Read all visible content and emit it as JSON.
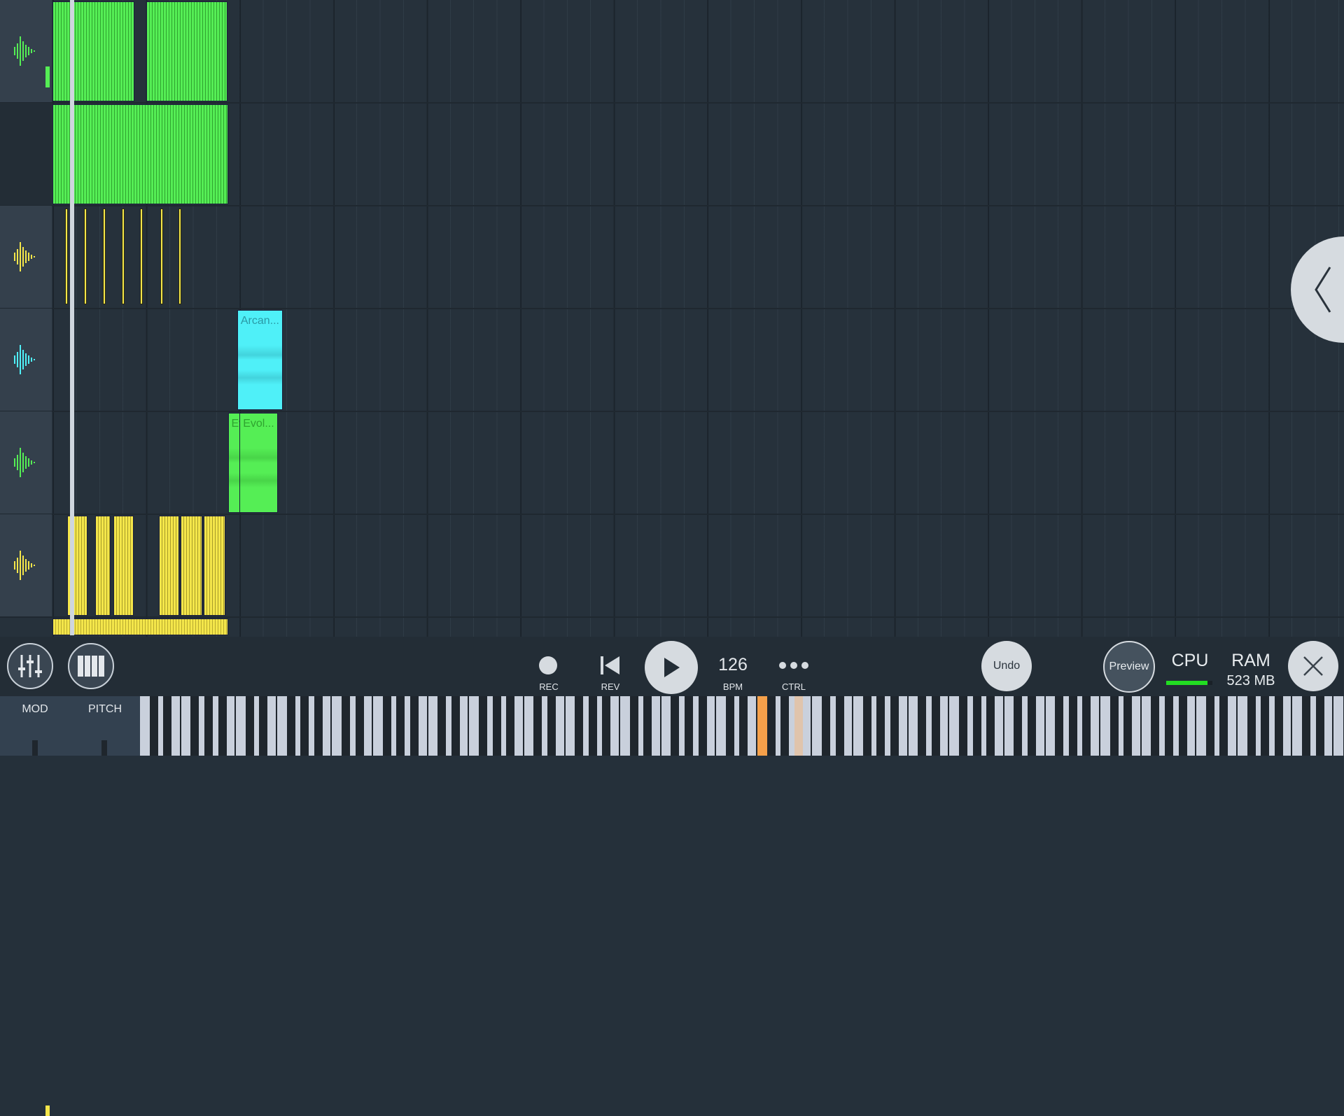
{
  "playlist": {
    "beat_grid": "beats",
    "playhead_beat": 0.85,
    "tracks": [
      {
        "color": "#55ee55",
        "icon": "waveform-icon",
        "level": 0.2,
        "clips": [
          {
            "start": 0,
            "length": 3.5,
            "label": ""
          },
          {
            "start": 4,
            "length": 3.5,
            "label": ""
          }
        ]
      },
      {
        "color": "#55ee55",
        "icon": "",
        "clips": [
          {
            "start": 0,
            "length": 7.5,
            "label": ""
          }
        ]
      },
      {
        "color": "#f4e64a",
        "icon": "waveform-icon",
        "hits": [
          0.55,
          1.35,
          2.15,
          2.95,
          3.75,
          4.6,
          5.4
        ]
      },
      {
        "color": "#4ff0f8",
        "icon": "waveform-icon",
        "clips": [
          {
            "start": 7.9,
            "length": 1.95,
            "label": "Arcan..."
          }
        ]
      },
      {
        "color": "#55ee55",
        "icon": "waveform-icon",
        "clips": [
          {
            "start": 7.5,
            "length": 2.15,
            "label": "Evol..."
          },
          {
            "start": 8.0,
            "length": 1.65,
            "label": "Evol..."
          }
        ]
      },
      {
        "color": "#f4e64a",
        "icon": "waveform-icon",
        "level": 0.1,
        "clips": [
          {
            "start": 0.63,
            "length": 0.87,
            "label": ""
          },
          {
            "start": 1.83,
            "length": 0.67,
            "label": ""
          },
          {
            "start": 2.6,
            "length": 0.87,
            "label": ""
          },
          {
            "start": 4.55,
            "length": 0.87,
            "label": ""
          },
          {
            "start": 5.48,
            "length": 0.92,
            "label": ""
          },
          {
            "start": 6.47,
            "length": 0.93,
            "label": ""
          }
        ]
      }
    ],
    "automation_strip": {
      "color": "#f4e64a",
      "start": 0,
      "length": 7.5
    },
    "side_button_icon": "chevron-left-icon"
  },
  "toolbar": {
    "mixer_icon": "mixer-icon",
    "piano_icon": "piano-icon",
    "rec_label": "REC",
    "rev_label": "REV",
    "bpm_value": "126",
    "bpm_label": "BPM",
    "ctrl_label": "CTRL",
    "undo_label": "Undo",
    "preview_label": "Preview",
    "cpu_label": "CPU",
    "cpu_level": 0.9,
    "ram_label": "RAM",
    "ram_value": "523 MB"
  },
  "keyboard": {
    "mod_label": "MOD",
    "pitch_label": "PITCH",
    "highlighted_keys": [
      {
        "white_index": 45,
        "color": "#f5a04a"
      },
      {
        "black_after_white": 47,
        "color": "#e0c4ac"
      }
    ]
  },
  "colors": {
    "accent": "#55ee55",
    "cpu_bar": "#22dd22"
  }
}
